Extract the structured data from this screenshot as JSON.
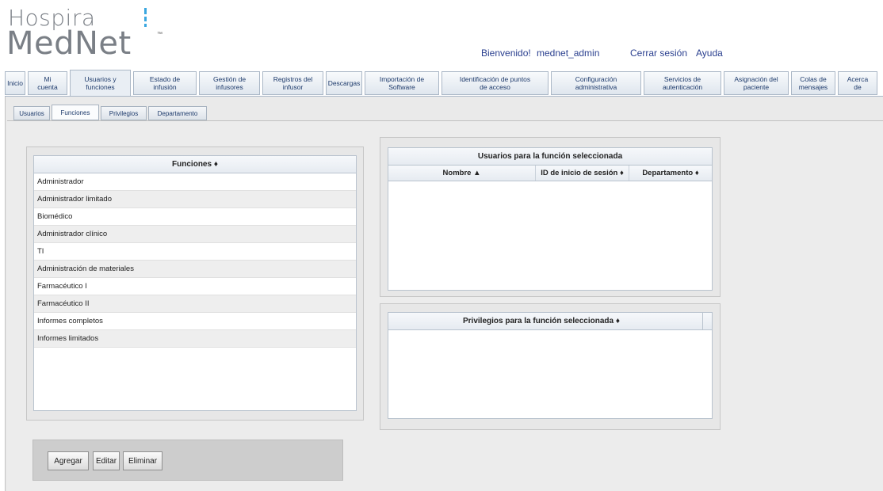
{
  "logo": {
    "line1": "Hospira",
    "line2": "MedNet",
    "tm": "™"
  },
  "header": {
    "welcome": "Bienvenido!",
    "username": "mednet_admin",
    "logout": "Cerrar sesión",
    "help": "Ayuda"
  },
  "main_tabs": [
    "Inicio",
    "Mi\ncuenta",
    "Usuarios y\nfunciones",
    "Estado de\ninfusión",
    "Gestión de\ninfusores",
    "Registros del\ninfusor",
    "Descargas",
    "Importación de\nSoftware",
    "Identificación de puntos\nde acceso",
    "Configuración\nadministrativa",
    "Servicios de\nautenticación",
    "Asignación del\npaciente",
    "Colas de\nmensajes",
    "Acerca\nde"
  ],
  "active_tab": "Usuarios y funciones",
  "sub_tabs": [
    "Usuarios",
    "Funciones",
    "Privilegios",
    "Departamento"
  ],
  "active_sub_tab": "Funciones",
  "functions_table": {
    "header": "Funciones ♦",
    "rows": [
      "Administrador",
      "Administrador limitado",
      "Biomédico",
      "Administrador clínico",
      "TI",
      "Administración de materiales",
      "Farmacéutico I",
      "Farmacéutico II",
      "Informes completos",
      "Informes limitados"
    ]
  },
  "users_table": {
    "title": "Usuarios para la función seleccionada",
    "columns": [
      "Nombre ▲",
      "ID de inicio de sesión ♦",
      "Departamento ♦"
    ]
  },
  "privileges_table": {
    "header": "Privilegios para la función seleccionada ♦"
  },
  "buttons": {
    "add": "Agregar",
    "edit": "Editar",
    "delete": "Eliminar"
  }
}
